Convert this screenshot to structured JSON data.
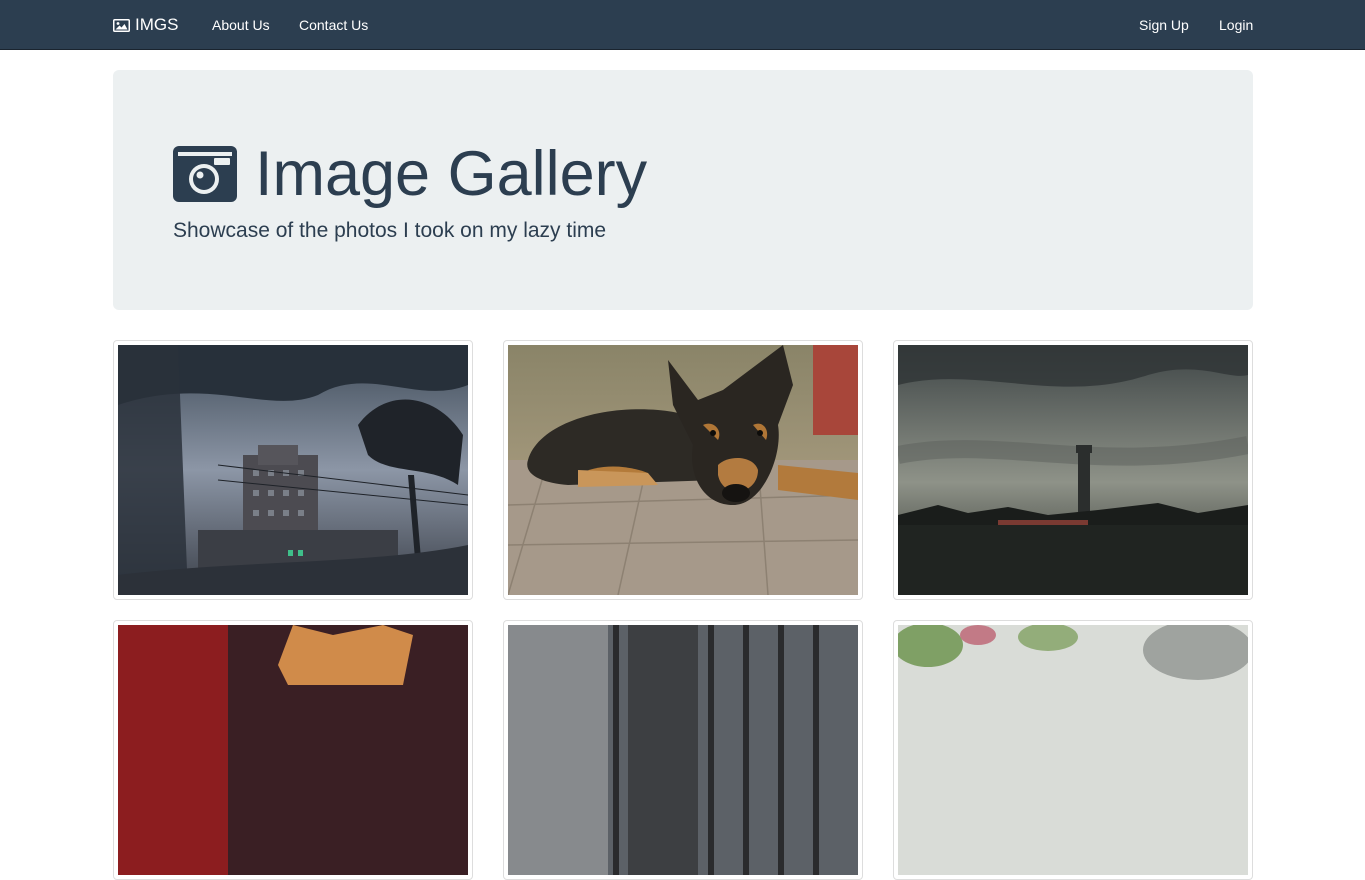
{
  "navbar": {
    "brand": "IMGS",
    "brand_icon": "picture-icon",
    "links": [
      "About Us",
      "Contact Us"
    ],
    "right_links": [
      "Sign Up",
      "Login"
    ],
    "background": "#2c3e50"
  },
  "hero": {
    "icon": "camera-icon",
    "title": "Image Gallery",
    "subtitle": "Showcase of the photos I took on my lazy time",
    "background": "#ecf0f1",
    "text_color": "#2c3e50"
  },
  "gallery": {
    "photos": [
      {
        "subject": "building reflected in a puddle"
      },
      {
        "subject": "dog lying on pavement"
      },
      {
        "subject": "tall tower under cloudy sky"
      },
      {
        "subject": "orange cat"
      },
      {
        "subject": "window bars"
      },
      {
        "subject": "green leaves"
      }
    ]
  }
}
